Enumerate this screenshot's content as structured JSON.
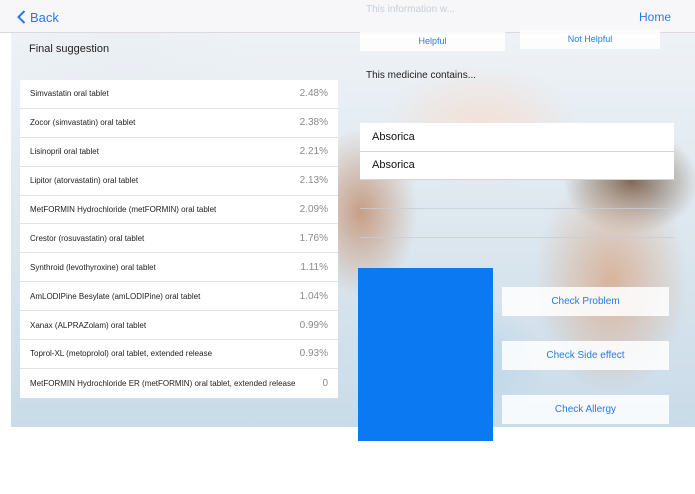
{
  "nav": {
    "back_label": "Back",
    "home_label": "Home",
    "top_hint": "This information w..."
  },
  "suggestions": {
    "title": "Final suggestion",
    "items": [
      {
        "name": "Simvastatin oral tablet",
        "percent": "2.48%"
      },
      {
        "name": "Zocor (simvastatin) oral tablet",
        "percent": "2.38%"
      },
      {
        "name": "Lisinopril oral tablet",
        "percent": "2.21%"
      },
      {
        "name": "Lipitor (atorvastatin) oral tablet",
        "percent": "2.13%"
      },
      {
        "name": "MetFORMIN Hydrochloride (metFORMIN) oral tablet",
        "percent": "2.09%"
      },
      {
        "name": "Crestor (rosuvastatin) oral tablet",
        "percent": "1.76%"
      },
      {
        "name": "Synthroid (levothyroxine) oral tablet",
        "percent": "1.11%"
      },
      {
        "name": "AmLODIPine Besylate (amLODIPine) oral tablet",
        "percent": "1.04%"
      },
      {
        "name": "Xanax (ALPRAZolam) oral tablet",
        "percent": "0.99%"
      },
      {
        "name": "Toprol-XL (metoprolol) oral tablet, extended release",
        "percent": "0.93%"
      },
      {
        "name": "MetFORMIN Hydrochloride ER (metFORMIN) oral tablet, extended release",
        "percent": "0"
      }
    ]
  },
  "feedback": {
    "helpful_label": "Helpful",
    "not_helpful_label": "Not Helpful"
  },
  "medicine": {
    "contains_label": "This medicine contains...",
    "ingredients": [
      "Absorica",
      "Absorica"
    ]
  },
  "actions": {
    "check_problem": "Check Problem",
    "check_side_effect": "Check Side effect",
    "check_allergy": "Check Allergy"
  },
  "colors": {
    "accent": "#2a7ae2",
    "block": "#0a79f2"
  }
}
